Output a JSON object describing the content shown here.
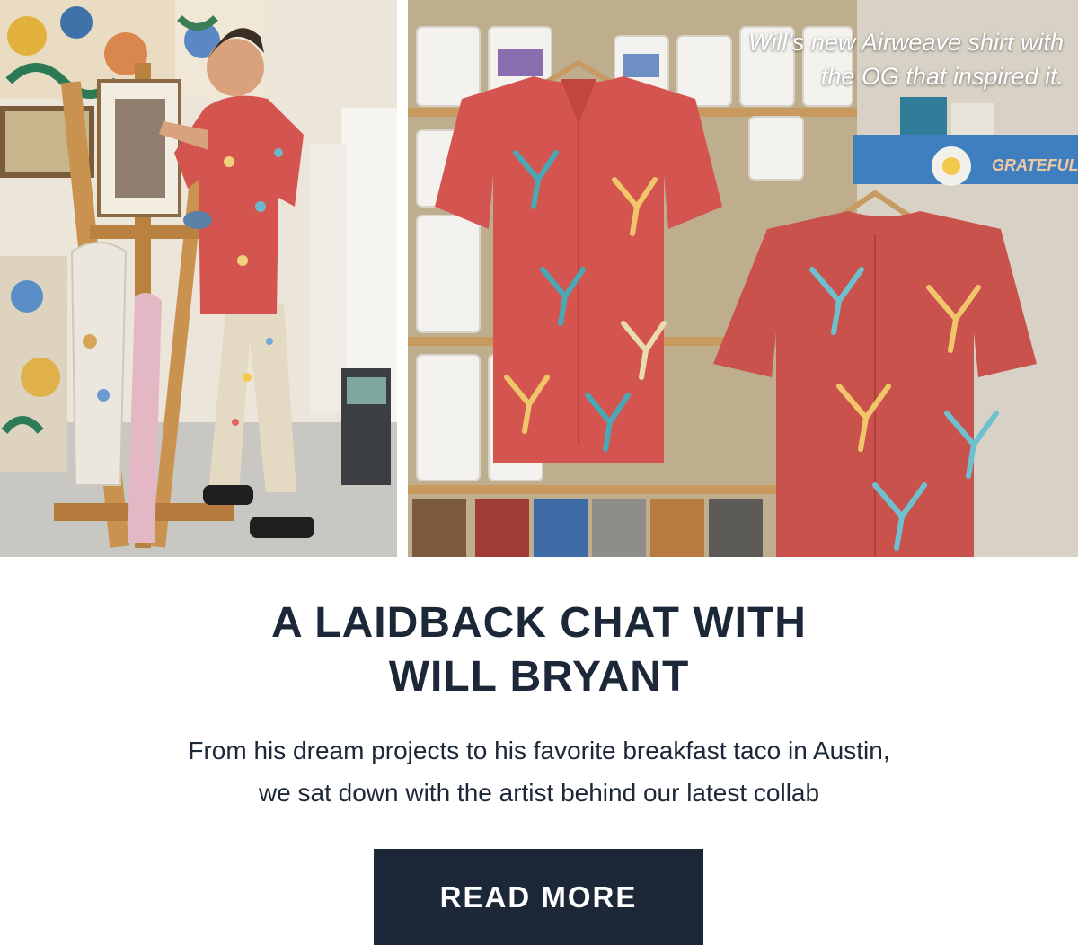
{
  "hero": {
    "left_photo_alt": "Artist painting at an easel wearing a red floral shirt",
    "right_photo_alt": "Two red floral shirts hanging in front of shelves of paint cans",
    "caption_line1": "Will’s new Airweave shirt with",
    "caption_line2": "the OG that inspired it.",
    "sticker_text": "GRATEFUL"
  },
  "article": {
    "headline_line1": "A LAIDBACK CHAT WITH",
    "headline_line2": "WILL BRYANT",
    "subtext_line1": "From his dream projects to his favorite breakfast taco in Austin,",
    "subtext_line2": "we sat down with the artist behind our latest collab",
    "cta_label": "READ MORE"
  },
  "colors": {
    "navy": "#1c2838",
    "shirt_red": "#d4554f",
    "wood": "#c9924f"
  }
}
